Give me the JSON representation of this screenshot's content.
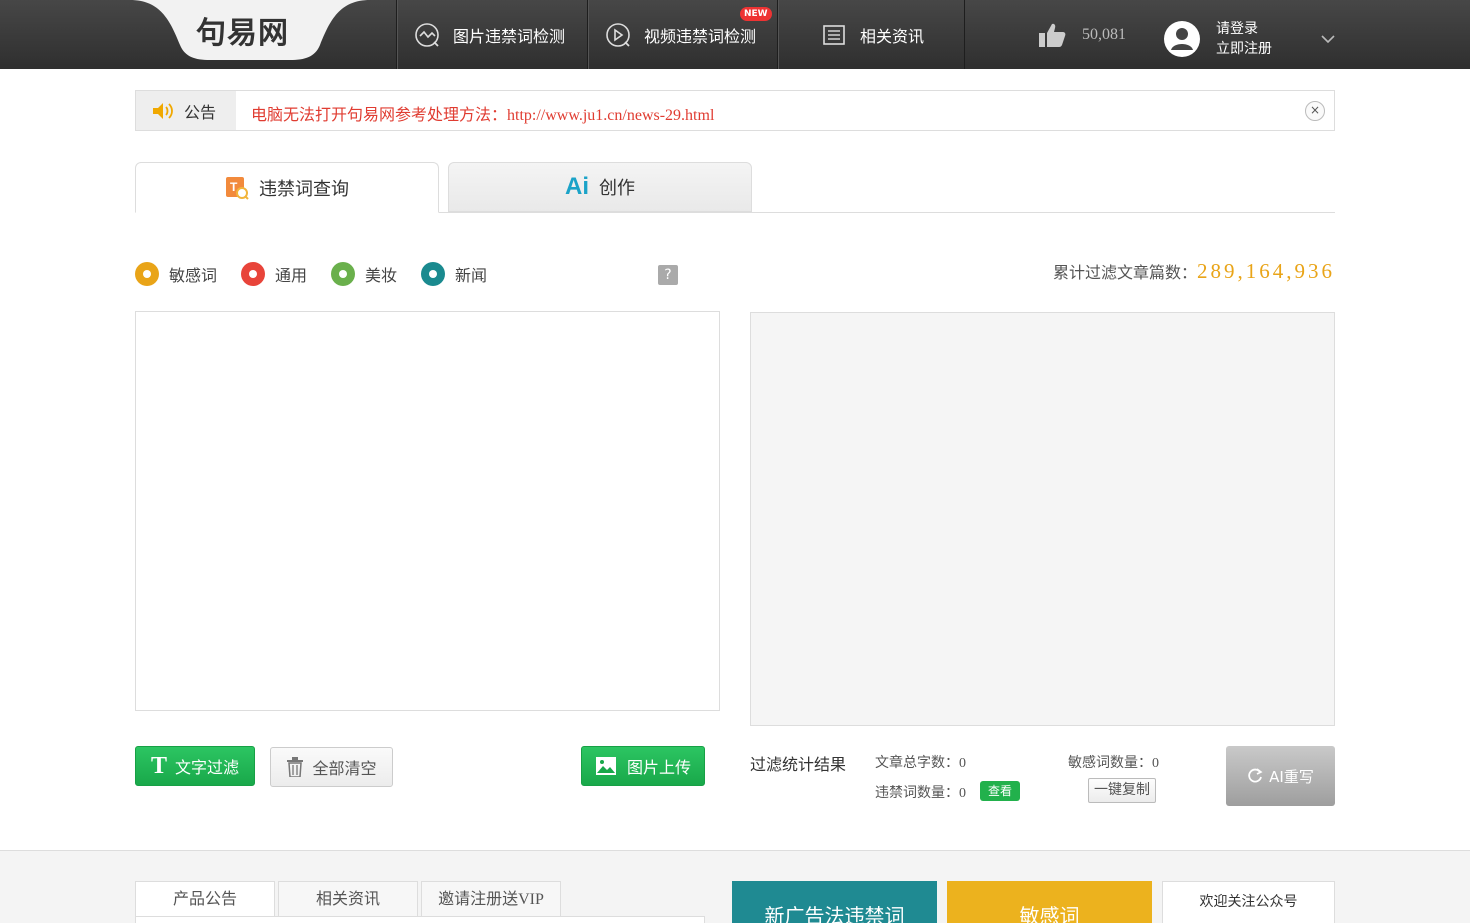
{
  "header": {
    "logo_text": "句易网",
    "nav": [
      {
        "label": "图片违禁词检测",
        "icon": "image-check-icon"
      },
      {
        "label": "视频违禁词检测",
        "icon": "video-check-icon",
        "badge": "NEW"
      },
      {
        "label": "相关资讯",
        "icon": "news-icon"
      }
    ],
    "likes": "50,081",
    "login": "请登录",
    "register": "立即注册"
  },
  "notice": {
    "label": "公告",
    "text": "电脑无法打开句易网参考处理方法：http://www.ju1.cn/news-29.html",
    "close": "×"
  },
  "tabs": [
    {
      "label": "违禁词查询",
      "active": true
    },
    {
      "label": "创作",
      "icon_text": "Ai",
      "active": false
    }
  ],
  "options": [
    {
      "label": "敏感词",
      "color": "#e9a418"
    },
    {
      "label": "通用",
      "color": "#e8443a"
    },
    {
      "label": "美妆",
      "color": "#6ab04c"
    },
    {
      "label": "新闻",
      "color": "#1a8a8f"
    }
  ],
  "help": "?",
  "total": {
    "label": "累计过滤文章篇数：",
    "value": "289,164,936"
  },
  "buttons": {
    "filter": "文字过滤",
    "clear": "全部清空",
    "upload": "图片上传",
    "ai_rewrite": "AI重写",
    "view": "查看",
    "copy": "一键复制"
  },
  "stats": {
    "title": "过滤统计结果",
    "total_chars": "文章总字数：0",
    "sensitive_count": "敏感词数量：0",
    "banned_count": "违禁词数量：0"
  },
  "footer": {
    "tabs": [
      "产品公告",
      "相关资讯",
      "邀请注册送VIP"
    ],
    "promo1": "新广告法违禁词",
    "promo2": "敏感词",
    "follow": "欢迎关注公众号"
  }
}
